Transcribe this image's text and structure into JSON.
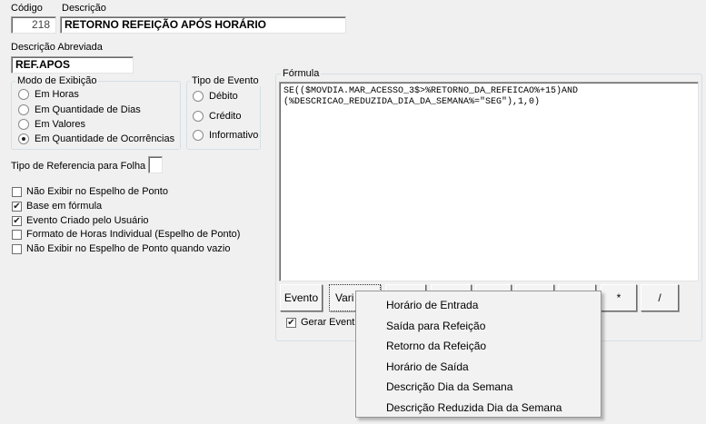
{
  "codigo": {
    "label": "Código",
    "value": "218"
  },
  "descricao": {
    "label": "Descrição",
    "value": "RETORNO REFEIÇÃO APÓS HORÁRIO"
  },
  "descricao_abreviada": {
    "label": "Descrição Abreviada",
    "value": "REF.APOS"
  },
  "modo_exibicao": {
    "title": "Modo de Exibição",
    "options": [
      "Em Horas",
      "Em Quantidade de Dias",
      "Em Valores",
      "Em Quantidade de Ocorrências"
    ],
    "selected": "Em Quantidade de Ocorrências"
  },
  "tipo_evento": {
    "title": "Tipo de Evento",
    "options": [
      "Débito",
      "Crédito",
      "Informativo"
    ]
  },
  "tipo_referencia": {
    "label": "Tipo de Referencia para Folha",
    "value": ""
  },
  "checkboxes": [
    {
      "label": "Não Exibir no Espelho de Ponto",
      "checked": false
    },
    {
      "label": "Base em fórmula",
      "checked": true
    },
    {
      "label": "Evento Criado pelo Usuário",
      "checked": true
    },
    {
      "label": "Formato de Horas Individual (Espelho de Ponto)",
      "checked": false
    },
    {
      "label": "Não Exibir no Espelho de Ponto quando vazio",
      "checked": false
    }
  ],
  "formula": {
    "title": "Fórmula",
    "line1": "SE(($MOVDIA.MAR_ACESSO_3$>%RETORNO_DA_REFEICAO%+15)AND",
    "line2": "(%DESCRICAO_REDUZIDA_DIA_DA_SEMANA%=\"SEG\"),1,0)"
  },
  "buttons": {
    "evento": "Evento",
    "variavel": "Vari",
    "multiply": "*",
    "divide": "/"
  },
  "gerar_evento": {
    "label": "Gerar Event",
    "checked": true
  },
  "menu": {
    "items": [
      "Horário de Entrada",
      "Saída para Refeição",
      "Retorno da Refeição",
      "Horário de Saída",
      "Descrição Dia da Semana",
      "Descrição Reduzida Dia da Semana"
    ]
  },
  "check_mark": "✔"
}
